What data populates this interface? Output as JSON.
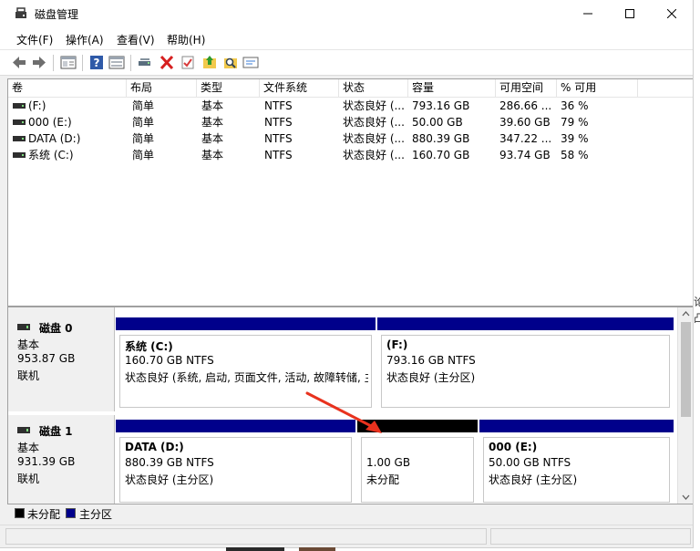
{
  "window": {
    "title": "磁盘管理"
  },
  "menu": [
    "文件(F)",
    "操作(A)",
    "查看(V)",
    "帮助(H)"
  ],
  "columns": [
    "卷",
    "布局",
    "类型",
    "文件系统",
    "状态",
    "容量",
    "可用空间",
    "% 可用"
  ],
  "volumes": [
    {
      "name": " (F:)",
      "layout": "简单",
      "type": "基本",
      "fs": "NTFS",
      "status": "状态良好 (...",
      "capacity": "793.16 GB",
      "free": "286.66 ...",
      "pct": "36 %"
    },
    {
      "name": "000 (E:)",
      "layout": "简单",
      "type": "基本",
      "fs": "NTFS",
      "status": "状态良好 (...",
      "capacity": "50.00 GB",
      "free": "39.60 GB",
      "pct": "79 %"
    },
    {
      "name": "DATA (D:)",
      "layout": "简单",
      "type": "基本",
      "fs": "NTFS",
      "status": "状态良好 (...",
      "capacity": "880.39 GB",
      "free": "347.22 ...",
      "pct": "39 %"
    },
    {
      "name": "系统 (C:)",
      "layout": "简单",
      "type": "基本",
      "fs": "NTFS",
      "status": "状态良好 (...",
      "capacity": "160.70 GB",
      "free": "93.74 GB",
      "pct": "58 %"
    }
  ],
  "disks": [
    {
      "name": "磁盘 0",
      "kind": "基本",
      "size": "953.87 GB",
      "state": "联机",
      "partitions": [
        {
          "title": "系统  (C:)",
          "size": "160.70 GB NTFS",
          "status": "状态良好 (系统, 启动, 页面文件, 活动, 故障转储, 主"
        },
        {
          "title": "  (F:)",
          "size": "793.16 GB NTFS",
          "status": "状态良好 (主分区)"
        }
      ]
    },
    {
      "name": "磁盘 1",
      "kind": "基本",
      "size": "931.39 GB",
      "state": "联机",
      "partitions": [
        {
          "title": "DATA  (D:)",
          "size": "880.39 GB NTFS",
          "status": "状态良好 (主分区)"
        },
        {
          "title": "",
          "size": "1.00 GB",
          "status": "未分配"
        },
        {
          "title": "000  (E:)",
          "size": "50.00 GB NTFS",
          "status": "状态良好 (主分区)"
        }
      ]
    }
  ],
  "legend": {
    "unallocated": "未分配",
    "primary": "主分区"
  },
  "colors": {
    "primary": "#00008b",
    "unallocated": "#000000",
    "arrow": "#e8321e"
  },
  "bg_clip": [
    "论",
    "凸"
  ],
  "icons": [
    "app-disk-icon",
    "minimize-icon",
    "maximize-icon",
    "close-icon",
    "back-arrow-icon",
    "forward-arrow-icon",
    "properties-icon",
    "help-icon",
    "console-icon",
    "connect-icon",
    "delete-icon",
    "check-icon",
    "up-folder-icon",
    "search-icon",
    "settings-icon"
  ]
}
